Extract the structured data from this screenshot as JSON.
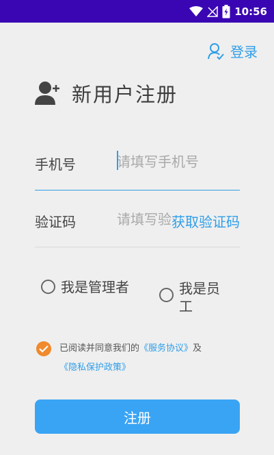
{
  "status_bar": {
    "time": "10:56"
  },
  "header": {
    "login_label": "登录"
  },
  "page": {
    "title": "新用户注册"
  },
  "form": {
    "phone": {
      "label": "手机号",
      "placeholder": "请填写手机号",
      "value": ""
    },
    "code": {
      "label": "验证码",
      "placeholder": "请填写验证码",
      "value": "",
      "get_code_label": "获取验证码"
    }
  },
  "roles": [
    {
      "label": "我是管理者",
      "selected": false
    },
    {
      "label": "我是员工",
      "selected": false
    }
  ],
  "agreement": {
    "checked": true,
    "prefix": "已阅读并同意我们的",
    "service_link": "《服务协议》",
    "and": "及",
    "privacy_link": "《隐私保护政策》"
  },
  "submit": {
    "label": "注册"
  },
  "colors": {
    "accent": "#2f9ee8",
    "button": "#3aa4f4",
    "status_bar": "#3a06b3",
    "checkbox": "#f08a2c",
    "background": "#efefef"
  }
}
